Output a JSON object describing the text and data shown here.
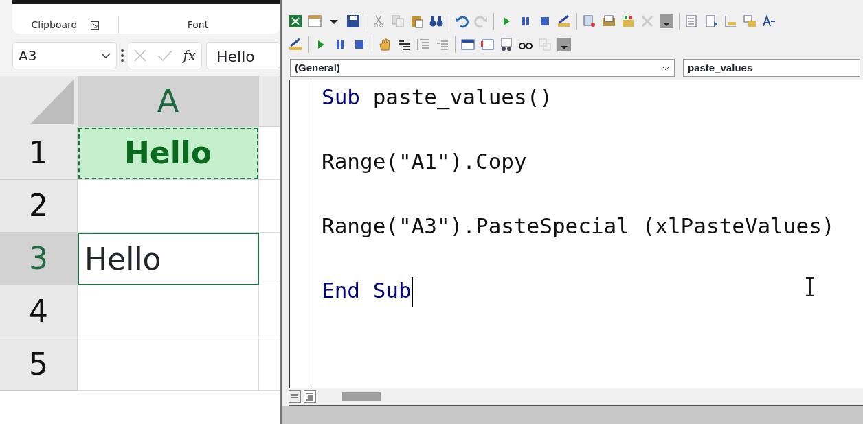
{
  "ribbon": {
    "groups": [
      {
        "label": "Clipboard",
        "launcher": true
      },
      {
        "label": "Font",
        "launcher": false
      }
    ]
  },
  "formula_bar": {
    "name_box": "A3",
    "function_label": "fx",
    "value": "Hello"
  },
  "sheet": {
    "columns": [
      {
        "label": "A",
        "selected": true
      }
    ],
    "rows": [
      {
        "label": "1",
        "selected": false,
        "cell": "Hello",
        "kind": "copied"
      },
      {
        "label": "2",
        "selected": false,
        "kind": "empty"
      },
      {
        "label": "3",
        "selected": true,
        "cell": "Hello",
        "kind": "active"
      },
      {
        "label": "4",
        "selected": false,
        "kind": "empty"
      },
      {
        "label": "5",
        "selected": false,
        "kind": "empty"
      }
    ]
  },
  "editor": {
    "object_combo": "(General)",
    "procedure_combo": "paste_values",
    "lines": [
      {
        "segments": [
          {
            "text": "Sub",
            "kind": "keyword"
          },
          {
            "text": " paste_values()",
            "kind": "plain"
          }
        ]
      },
      {
        "segments": [
          {
            "text": "Range(\"A1\").Copy",
            "kind": "plain"
          }
        ]
      },
      {
        "segments": [
          {
            "text": "Range(\"A3\").PasteSpecial (xlPasteValues)",
            "kind": "plain"
          }
        ]
      },
      {
        "segments": [
          {
            "text": "End Sub",
            "kind": "keyword"
          }
        ],
        "caret": true
      }
    ]
  }
}
